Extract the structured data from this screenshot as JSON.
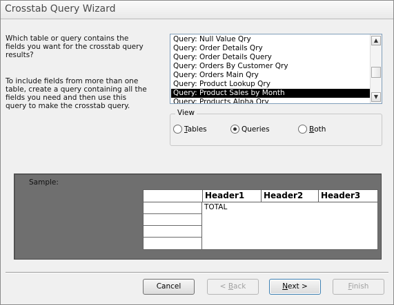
{
  "window": {
    "title": "Crosstab Query Wizard"
  },
  "prompt": {
    "question": [
      "Which table or query contains the",
      "fields you want for the crosstab query",
      "results?"
    ],
    "hint": [
      "To include fields from more than one",
      "table, create a query containing all the",
      "fields you need and then use this",
      "query to make the crosstab query."
    ]
  },
  "list": {
    "items": [
      "Query: Null Value Qry",
      "Query: Order Details Qry",
      "Query: Order Details Query",
      "Query: Orders By Customer Qry",
      "Query: Orders Main Qry",
      "Query: Product Lookup Qry",
      "Query: Product Sales by Month",
      "Query: Products Alpha Qry",
      "Query: ..."
    ],
    "selected_index": 6
  },
  "view": {
    "label": "View",
    "options": [
      {
        "label": "Tables",
        "key": "T",
        "rest": "ables",
        "checked": false
      },
      {
        "label": "Queries",
        "key": "",
        "rest": "Queries",
        "checked": true
      },
      {
        "label": "Both",
        "key": "B",
        "pre": "",
        "rest": "oth",
        "checked": false
      }
    ]
  },
  "sample": {
    "label": "Sample:",
    "headers": [
      "Header1",
      "Header2",
      "Header3"
    ],
    "total_label": "TOTAL"
  },
  "buttons": {
    "cancel": "Cancel",
    "back_pre": "< ",
    "back_key": "B",
    "back_rest": "ack",
    "next_key": "N",
    "next_rest": "ext >",
    "finish_key": "F",
    "finish_rest": "inish"
  }
}
